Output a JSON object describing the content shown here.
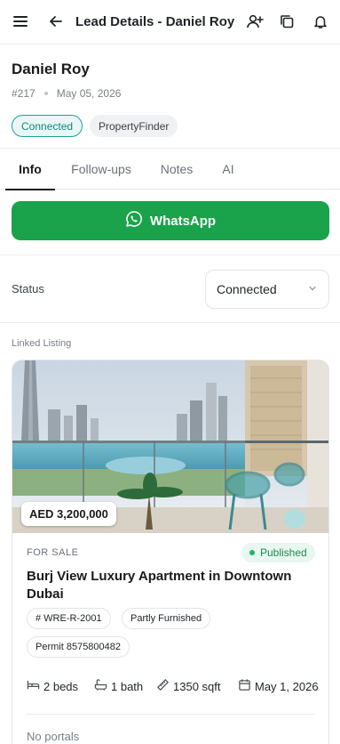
{
  "header": {
    "title": "Lead Details - Daniel Roy",
    "icons": [
      "menu-icon",
      "back-arrow-icon",
      "add-user-icon",
      "copy-icon",
      "bell-icon"
    ]
  },
  "lead": {
    "name": "Daniel Roy",
    "id": "#217",
    "date": "May 05, 2026",
    "status_badge": "Connected",
    "source_badge": "PropertyFinder"
  },
  "tabs": [
    {
      "label": "Info",
      "active": true
    },
    {
      "label": "Follow-ups",
      "active": false
    },
    {
      "label": "Notes",
      "active": false
    },
    {
      "label": "AI",
      "active": false
    }
  ],
  "whatsapp": {
    "label": "WhatsApp",
    "color": "#1aa34a"
  },
  "status": {
    "label": "Status",
    "value": "Connected"
  },
  "linked_listing": {
    "section_label": "Linked Listing",
    "price": "AED 3,200,000",
    "type": "FOR SALE",
    "state": "Published",
    "title": "Burj View Luxury Apartment in Downtown Dubai",
    "chips": [
      "# WRE-R-2001",
      "Partly Furnished",
      "Permit 8575800482"
    ],
    "specs": {
      "beds": "2 beds",
      "baths": "1 bath",
      "area": "1350 sqft",
      "date": "May 1, 2026"
    },
    "portals": "No portals"
  },
  "colors": {
    "accent_teal": "#1aa39a",
    "published_green": "#22b06a"
  }
}
